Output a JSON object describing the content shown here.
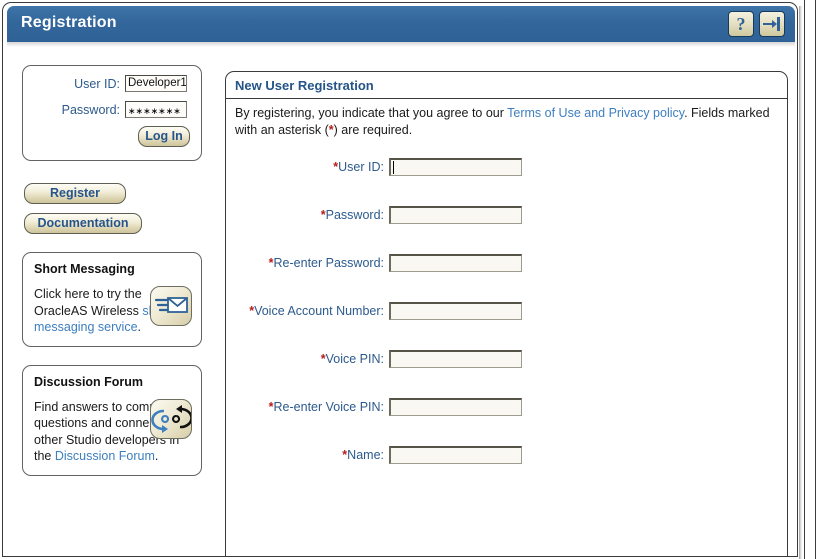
{
  "window": {
    "title": "Registration",
    "help_icon": "question-mark-icon",
    "logout_icon": "logout-arrow-icon"
  },
  "login_box": {
    "user_id_label": "User ID:",
    "user_id_value": "Developer1",
    "password_label": "Password:",
    "password_value": "∗∗∗∗∗∗∗",
    "login_button": "Log In"
  },
  "side_buttons": [
    {
      "label": "Register",
      "name": "register-button"
    },
    {
      "label": "Documentation",
      "name": "documentation-button"
    }
  ],
  "short_messaging": {
    "title": "Short Messaging",
    "text_before": "Click here to try the OracleAS Wireless ",
    "link_text": "short messaging service",
    "text_after": ".",
    "icon": "envelope-icon"
  },
  "discussion_forum": {
    "title": "Discussion Forum",
    "text_before": "Find answers to common questions and connect with other Studio developers in the ",
    "link_text": "Discussion Forum",
    "text_after": ".",
    "icon": "circular-arrows-icon"
  },
  "main": {
    "heading": "New User Registration",
    "intro_before": "By registering, you indicate that you agree to our ",
    "intro_link": "Terms of Use and Privacy policy",
    "intro_middle": ". Fields marked with an asterisk (",
    "intro_star": "*",
    "intro_after": ") are required.",
    "fields": [
      {
        "label": "User ID:",
        "value": "",
        "name": "user-id-field",
        "focused": true
      },
      {
        "label": "Password:",
        "value": "",
        "name": "password-field",
        "focused": false
      },
      {
        "label": "Re-enter Password:",
        "value": "",
        "name": "re-enter-password-field",
        "focused": false
      },
      {
        "label": "Voice Account Number:",
        "value": "",
        "name": "voice-account-number-field",
        "focused": false
      },
      {
        "label": "Voice PIN:",
        "value": "",
        "name": "voice-pin-field",
        "focused": false
      },
      {
        "label": "Re-enter Voice PIN:",
        "value": "",
        "name": "re-enter-voice-pin-field",
        "focused": false
      },
      {
        "label": "Name:",
        "value": "",
        "name": "name-field",
        "focused": false
      }
    ]
  },
  "colors": {
    "titlebar": "#33679c",
    "link": "#3d7fbf",
    "label": "#2c5a8c",
    "required_star": "#b71c1c",
    "button_text": "#27558a"
  }
}
